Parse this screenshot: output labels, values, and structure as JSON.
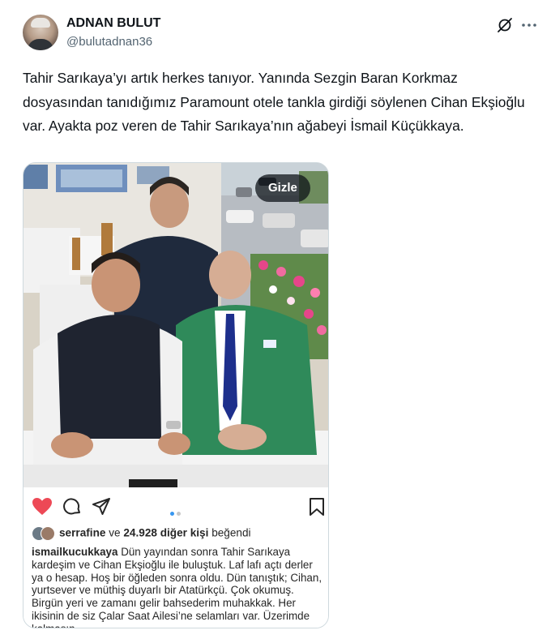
{
  "author": {
    "name": "ADNAN BULUT",
    "handle": "@bulutadnan36"
  },
  "icons": {
    "grok": "grok-icon",
    "more": "more-icon"
  },
  "tweet": {
    "text": "Tahir Sarıkaya’yı artık herkes tanıyor. Yanında Sezgin Baran Korkmaz dosyasından tanıdığımız Paramount otele tankla girdiği söylenen Cihan Ekşioğlu var. Ayakta poz veren de Tahir Sarıkaya’nın ağabeyi İsmail Küçükkaya."
  },
  "media": {
    "hide_label": "Gizle"
  },
  "instagram": {
    "colors": {
      "heart": "#ed4956",
      "active_dot": "#3897f0"
    },
    "carousel": {
      "count": 2,
      "active": 1
    },
    "likes": {
      "user": "serrafine",
      "connector": "ve",
      "count": "24.928 diğer kişi",
      "suffix": "beğendi"
    },
    "caption": {
      "user": "ismailkucukkaya",
      "text": "Dün yayından sonra Tahir Sarıkaya kardeşim ve Cihan Ekşioğlu ile buluştuk. Laf lafı açtı derler ya o hesap. Hoş bir öğleden sonra oldu. Dün tanıştık; Cihan, yurtsever ve müthiş duyarlı bir Atatürkçü. Çok okumuş. Birgün yeri ve zamanı gelir bahsederim muhakkak. Her ikisinin de siz Çalar Saat Ailesi’ne selamları var. Üzerimde kalmasın."
    }
  }
}
